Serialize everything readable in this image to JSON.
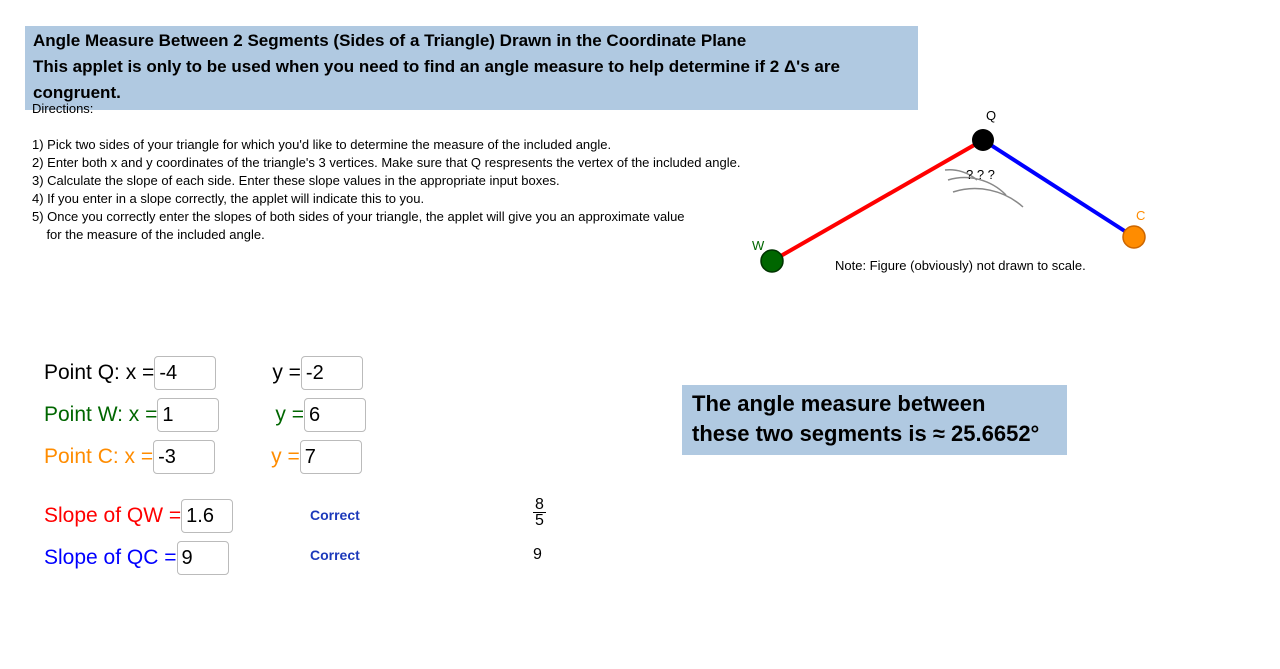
{
  "header": {
    "title": "Angle Measure Between 2 Segments (Sides of a Triangle) Drawn in the Coordinate Plane",
    "subtitle": "This applet is only to be used when you need to find an angle measure to help determine if 2 Δ's are congruent."
  },
  "directions": {
    "title": "Directions:",
    "d1": "1) Pick two sides of your triangle for which you'd like to determine the measure of the included angle.",
    "d2": "2) Enter both x and y coordinates of the triangle's 3 vertices.  Make sure that Q respresents the vertex of the included angle.",
    "d3": "3) Calculate the slope of each side. Enter these slope values in the appropriate input boxes.",
    "d4": "4) If you enter in a slope correctly, the applet will indicate this to you.",
    "d5a": "5) Once you correctly enter the slopes of both sides of your triangle, the applet will give you an approximate value",
    "d5b": "    for the measure of the included angle."
  },
  "diagram": {
    "labelQ": "Q",
    "labelW": "W",
    "labelC": "C",
    "angleMark": "? ? ?",
    "note": "Note: Figure (obviously) not drawn to scale."
  },
  "points": {
    "q": {
      "labelX": "Point Q: x =",
      "x": "-4",
      "labelY": "y =",
      "y": "-2"
    },
    "w": {
      "labelX": "Point W: x =",
      "x": "1",
      "labelY": "y =",
      "y": "6"
    },
    "c": {
      "labelX": "Point C: x =",
      "x": "-3",
      "labelY": "y =",
      "y": "7"
    }
  },
  "slopes": {
    "qw": {
      "label": "Slope of QW =",
      "value": "1.6",
      "status": "Correct",
      "fracNum": "8",
      "fracDen": "5"
    },
    "qc": {
      "label": "Slope of QC =",
      "value": "9",
      "status": "Correct",
      "actual": "9"
    }
  },
  "result": {
    "line1": "The angle measure between",
    "line2": "these two segments is ≈ 25.6652°"
  }
}
